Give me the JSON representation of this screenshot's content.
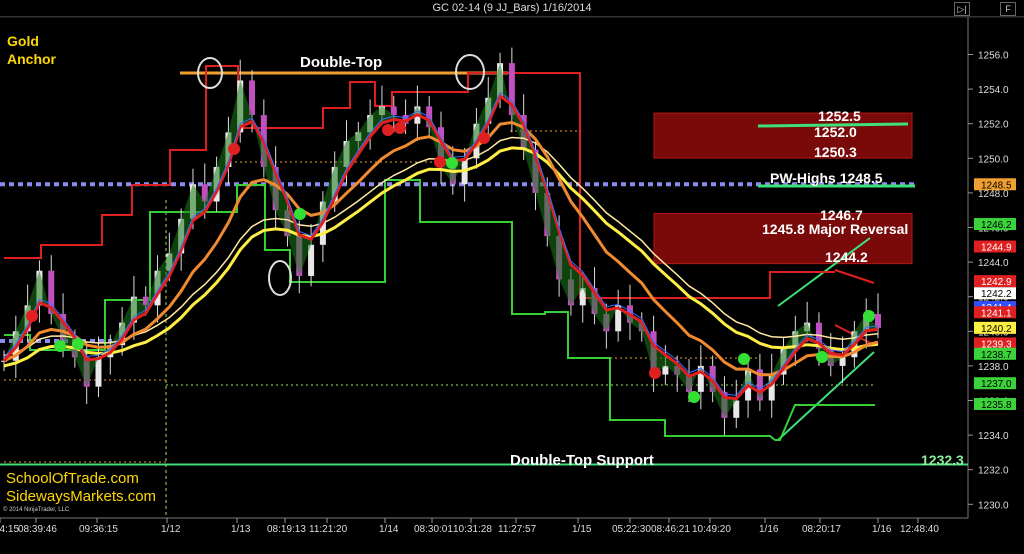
{
  "window": {
    "title": "GC 02-14 (9 JJ_Bars)  1/16/2014",
    "btn_left": "▷|",
    "btn_right": "F"
  },
  "labels": {
    "instrument": "Gold",
    "indicator": "Anchor",
    "copyright": "© 2014 NinjaTrader, LLC",
    "site1": "SchoolOfTrade.com",
    "site2": "SidewaysMarkets.com"
  },
  "chart_data": {
    "type": "candlestick",
    "title": "GC 02-14 (9 JJ_Bars)  1/16/2014",
    "ylim": [
      1230.0,
      1257.0
    ],
    "y_ticks": [
      "1256.0",
      "1254.0",
      "1252.0",
      "1250.0",
      "1248.0",
      "1246.0",
      "1244.0",
      "1242.0",
      "1240.0",
      "1238.0",
      "1236.0",
      "1234.0",
      "1232.0",
      "1230.0"
    ],
    "x_ticks": [
      "04:15",
      "08:39:46",
      "09:36:15",
      "1/12",
      "1/13",
      "08:19:13",
      "11:21:20",
      "1/14",
      "08:30:01",
      "10:31:28",
      "11:27:57",
      "1/15",
      "05:22:30",
      "08:46:21",
      "10:49:20",
      "1/16",
      "08:20:17",
      "1/16",
      "12:48:40"
    ],
    "price_tags": [
      {
        "value": "1248.5",
        "color": "#f0a030"
      },
      {
        "value": "1246.2",
        "color": "#3ad43a"
      },
      {
        "value": "1244.9",
        "color": "#e02020"
      },
      {
        "value": "1242.9",
        "color": "#e02020"
      },
      {
        "value": "1242.2",
        "color": "#ffffff"
      },
      {
        "value": "1241.4",
        "color": "#3050ff"
      },
      {
        "value": "1241.1",
        "color": "#e02020"
      },
      {
        "value": "1240.2",
        "color": "#ffee44"
      },
      {
        "value": "1239.3",
        "color": "#e02020"
      },
      {
        "value": "1238.7",
        "color": "#3ad43a"
      },
      {
        "value": "1237.0",
        "color": "#3ad43a"
      },
      {
        "value": "1235.8",
        "color": "#3ad43a"
      }
    ],
    "annotations": [
      {
        "text": "Double-Top",
        "price": 1256.0
      },
      {
        "text": "1252.5",
        "price": 1252.5
      },
      {
        "text": "1252.0",
        "price": 1252.0
      },
      {
        "text": "1250.3",
        "price": 1250.3
      },
      {
        "text": "PW-Highs 1248.5",
        "price": 1248.5
      },
      {
        "text": "1246.7",
        "price": 1246.7
      },
      {
        "text": "1245.8 Major Reversal",
        "price": 1245.8
      },
      {
        "text": "1244.2",
        "price": 1244.2
      },
      {
        "text": "Double-Top Support",
        "price": 1232.3
      },
      {
        "text": "1232.3",
        "price": 1232.3
      }
    ],
    "zones": [
      [
        1250.3,
        1252.5
      ],
      [
        1244.2,
        1246.7
      ]
    ],
    "levels": {
      "double_top": 1256.0,
      "pw_highs": 1248.5,
      "support": 1232.3
    },
    "closes": [
      1238.3,
      1240,
      1241.5,
      1243.5,
      1241,
      1239.5,
      1238.5,
      1236.8,
      1238.5,
      1239.2,
      1240.5,
      1242,
      1241.5,
      1243.5,
      1244.5,
      1246.5,
      1248.5,
      1247.5,
      1249.5,
      1251.5,
      1254.5,
      1252.5,
      1249.5,
      1247,
      1245.5,
      1243.2,
      1245,
      1247.5,
      1249.5,
      1251,
      1251.5,
      1252.5,
      1253,
      1252.5,
      1252,
      1253,
      1251.8,
      1249.5,
      1248.5,
      1250,
      1252,
      1253.5,
      1255.5,
      1252.5,
      1250.5,
      1248,
      1245.5,
      1243,
      1241.5,
      1242.5,
      1241,
      1240,
      1241.5,
      1240.5,
      1240,
      1237.5,
      1238,
      1237.5,
      1236.5,
      1238,
      1236.5,
      1235,
      1236,
      1237.8,
      1236,
      1237.5,
      1239,
      1240,
      1240.5,
      1239,
      1238,
      1238.5,
      1240,
      1241,
      1240.2
    ]
  }
}
